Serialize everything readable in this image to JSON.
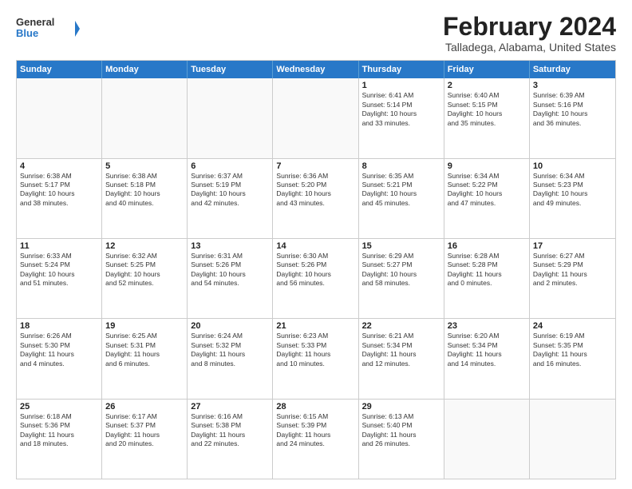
{
  "logo": {
    "line1": "General",
    "line2": "Blue"
  },
  "title": {
    "month_year": "February 2024",
    "location": "Talladega, Alabama, United States"
  },
  "calendar": {
    "headers": [
      "Sunday",
      "Monday",
      "Tuesday",
      "Wednesday",
      "Thursday",
      "Friday",
      "Saturday"
    ],
    "rows": [
      [
        {
          "day": "",
          "info": ""
        },
        {
          "day": "",
          "info": ""
        },
        {
          "day": "",
          "info": ""
        },
        {
          "day": "",
          "info": ""
        },
        {
          "day": "1",
          "info": "Sunrise: 6:41 AM\nSunset: 5:14 PM\nDaylight: 10 hours\nand 33 minutes."
        },
        {
          "day": "2",
          "info": "Sunrise: 6:40 AM\nSunset: 5:15 PM\nDaylight: 10 hours\nand 35 minutes."
        },
        {
          "day": "3",
          "info": "Sunrise: 6:39 AM\nSunset: 5:16 PM\nDaylight: 10 hours\nand 36 minutes."
        }
      ],
      [
        {
          "day": "4",
          "info": "Sunrise: 6:38 AM\nSunset: 5:17 PM\nDaylight: 10 hours\nand 38 minutes."
        },
        {
          "day": "5",
          "info": "Sunrise: 6:38 AM\nSunset: 5:18 PM\nDaylight: 10 hours\nand 40 minutes."
        },
        {
          "day": "6",
          "info": "Sunrise: 6:37 AM\nSunset: 5:19 PM\nDaylight: 10 hours\nand 42 minutes."
        },
        {
          "day": "7",
          "info": "Sunrise: 6:36 AM\nSunset: 5:20 PM\nDaylight: 10 hours\nand 43 minutes."
        },
        {
          "day": "8",
          "info": "Sunrise: 6:35 AM\nSunset: 5:21 PM\nDaylight: 10 hours\nand 45 minutes."
        },
        {
          "day": "9",
          "info": "Sunrise: 6:34 AM\nSunset: 5:22 PM\nDaylight: 10 hours\nand 47 minutes."
        },
        {
          "day": "10",
          "info": "Sunrise: 6:34 AM\nSunset: 5:23 PM\nDaylight: 10 hours\nand 49 minutes."
        }
      ],
      [
        {
          "day": "11",
          "info": "Sunrise: 6:33 AM\nSunset: 5:24 PM\nDaylight: 10 hours\nand 51 minutes."
        },
        {
          "day": "12",
          "info": "Sunrise: 6:32 AM\nSunset: 5:25 PM\nDaylight: 10 hours\nand 52 minutes."
        },
        {
          "day": "13",
          "info": "Sunrise: 6:31 AM\nSunset: 5:26 PM\nDaylight: 10 hours\nand 54 minutes."
        },
        {
          "day": "14",
          "info": "Sunrise: 6:30 AM\nSunset: 5:26 PM\nDaylight: 10 hours\nand 56 minutes."
        },
        {
          "day": "15",
          "info": "Sunrise: 6:29 AM\nSunset: 5:27 PM\nDaylight: 10 hours\nand 58 minutes."
        },
        {
          "day": "16",
          "info": "Sunrise: 6:28 AM\nSunset: 5:28 PM\nDaylight: 11 hours\nand 0 minutes."
        },
        {
          "day": "17",
          "info": "Sunrise: 6:27 AM\nSunset: 5:29 PM\nDaylight: 11 hours\nand 2 minutes."
        }
      ],
      [
        {
          "day": "18",
          "info": "Sunrise: 6:26 AM\nSunset: 5:30 PM\nDaylight: 11 hours\nand 4 minutes."
        },
        {
          "day": "19",
          "info": "Sunrise: 6:25 AM\nSunset: 5:31 PM\nDaylight: 11 hours\nand 6 minutes."
        },
        {
          "day": "20",
          "info": "Sunrise: 6:24 AM\nSunset: 5:32 PM\nDaylight: 11 hours\nand 8 minutes."
        },
        {
          "day": "21",
          "info": "Sunrise: 6:23 AM\nSunset: 5:33 PM\nDaylight: 11 hours\nand 10 minutes."
        },
        {
          "day": "22",
          "info": "Sunrise: 6:21 AM\nSunset: 5:34 PM\nDaylight: 11 hours\nand 12 minutes."
        },
        {
          "day": "23",
          "info": "Sunrise: 6:20 AM\nSunset: 5:34 PM\nDaylight: 11 hours\nand 14 minutes."
        },
        {
          "day": "24",
          "info": "Sunrise: 6:19 AM\nSunset: 5:35 PM\nDaylight: 11 hours\nand 16 minutes."
        }
      ],
      [
        {
          "day": "25",
          "info": "Sunrise: 6:18 AM\nSunset: 5:36 PM\nDaylight: 11 hours\nand 18 minutes."
        },
        {
          "day": "26",
          "info": "Sunrise: 6:17 AM\nSunset: 5:37 PM\nDaylight: 11 hours\nand 20 minutes."
        },
        {
          "day": "27",
          "info": "Sunrise: 6:16 AM\nSunset: 5:38 PM\nDaylight: 11 hours\nand 22 minutes."
        },
        {
          "day": "28",
          "info": "Sunrise: 6:15 AM\nSunset: 5:39 PM\nDaylight: 11 hours\nand 24 minutes."
        },
        {
          "day": "29",
          "info": "Sunrise: 6:13 AM\nSunset: 5:40 PM\nDaylight: 11 hours\nand 26 minutes."
        },
        {
          "day": "",
          "info": ""
        },
        {
          "day": "",
          "info": ""
        }
      ]
    ]
  }
}
